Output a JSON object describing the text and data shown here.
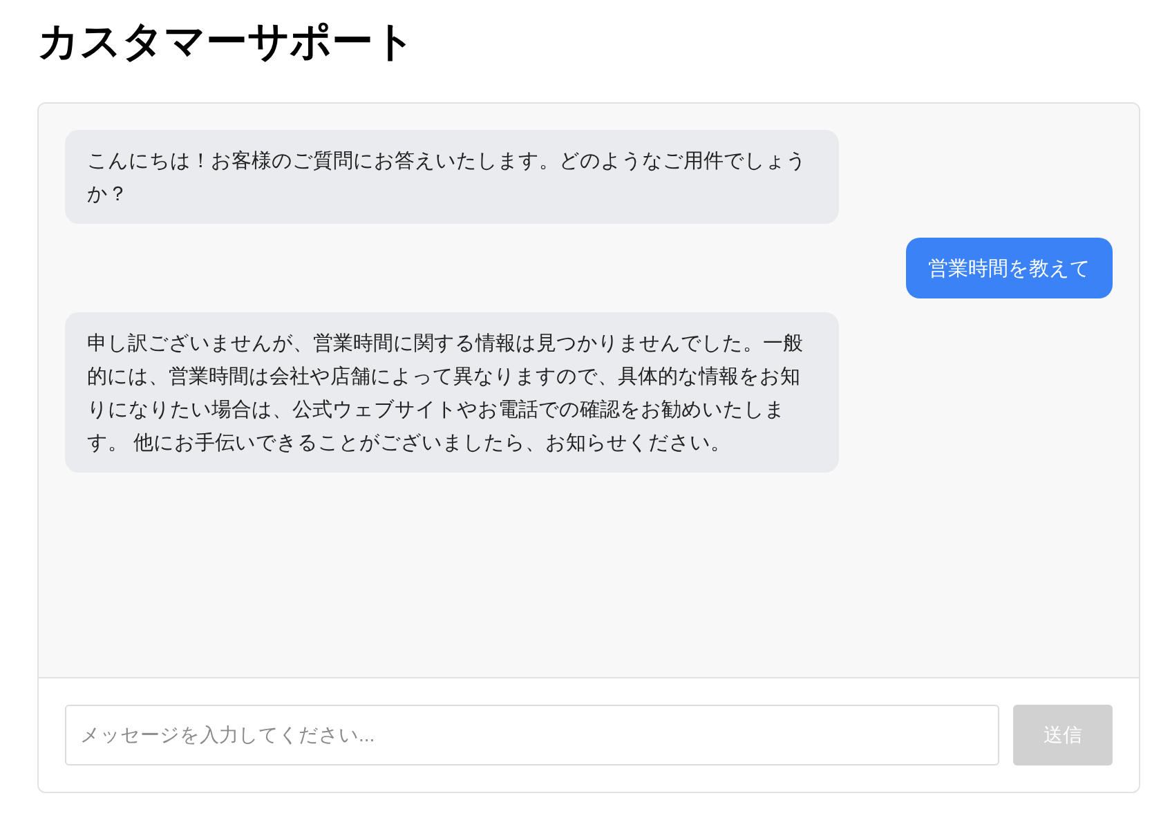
{
  "title": "カスタマーサポート",
  "messages": [
    {
      "kind": "bot",
      "text": "こんにちは！お客様のご質問にお答えいたします。どのようなご用件でしょうか？"
    },
    {
      "kind": "user",
      "text": "営業時間を教えて"
    },
    {
      "kind": "bot",
      "text": "申し訳ございませんが、営業時間に関する情報は見つかりませんでした。一般的には、営業時間は会社や店舗によって異なりますので、具体的な情報をお知りになりたい場合は、公式ウェブサイトやお電話での確認をお勧めいたします。 他にお手伝いできることがございましたら、お知らせください。"
    }
  ],
  "input": {
    "placeholder": "メッセージを入力してください..."
  },
  "send_button": {
    "label": "送信",
    "disabled": true
  }
}
